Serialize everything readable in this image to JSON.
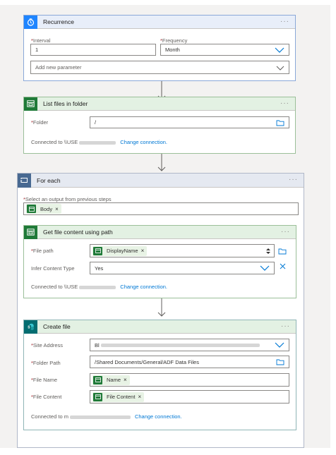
{
  "recurrence": {
    "title": "Recurrence",
    "interval_label": "Interval",
    "interval_value": "1",
    "frequency_label": "Frequency",
    "frequency_value": "Month",
    "add_param_placeholder": "Add new parameter"
  },
  "list_files": {
    "title": "List files in folder",
    "folder_label": "Folder",
    "folder_value": "/",
    "connected_prefix": "Connected to \\\\USE",
    "change_connection": "Change connection."
  },
  "for_each": {
    "title": "For each",
    "select_label": "Select an output from previous steps",
    "token": "Body"
  },
  "get_file": {
    "title": "Get file content using path",
    "file_path_label": "File path",
    "file_path_token": "DisplayName",
    "infer_label": "Infer Content Type",
    "infer_value": "Yes",
    "connected_prefix": "Connected to \\\\USE",
    "change_connection": "Change connection."
  },
  "create_file": {
    "title": "Create file",
    "site_label": "Site Address",
    "site_value": "Bl",
    "folder_label": "Folder Path",
    "folder_value": "/Shared Documents/General/ADF Data Files",
    "name_label": "File Name",
    "name_token": "Name",
    "content_label": "File Content",
    "content_token": "File Content",
    "connected_prefix": "Connected to m",
    "change_connection": "Change connection."
  },
  "colors": {
    "recurrence_header": "#e8eef9",
    "recurrence_icon": "#1f85ff",
    "onedrive_header": "#e3f1e3",
    "onedrive_icon": "#1f7a38",
    "foreach_header": "#e5e9f1",
    "foreach_icon": "#486991",
    "sharepoint_icon": "#036c70",
    "link": "#0078d4"
  },
  "icons": {
    "recurrence": "clock-icon",
    "fs": "filesystem-icon",
    "foreach": "loop-icon",
    "sharepoint": "sharepoint-icon",
    "more": "ellipsis-icon",
    "chevron": "chevron-down-icon",
    "folder": "folder-browse-icon",
    "close": "close-icon"
  }
}
